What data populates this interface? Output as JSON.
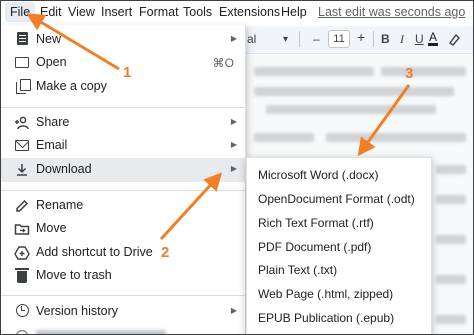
{
  "menubar": {
    "items": [
      "File",
      "Edit",
      "View",
      "Insert",
      "Format",
      "Tools",
      "Extensions",
      "Help"
    ],
    "last_edit": "Last edit was seconds ago"
  },
  "toolbar": {
    "partial_text": "al",
    "dropdown_caret": "▾",
    "minus": "–",
    "font_size": "11",
    "plus": "+",
    "bold": "B",
    "italic": "I",
    "underline": "U",
    "text_color": "A"
  },
  "file_menu": {
    "items": [
      {
        "icon": "document-icon",
        "label": "New",
        "submenu": true
      },
      {
        "icon": "folder-icon",
        "label": "Open",
        "shortcut": "⌘O"
      },
      {
        "icon": "copy-icon",
        "label": "Make a copy"
      },
      {
        "icon": "share-person-icon",
        "label": "Share",
        "submenu": true
      },
      {
        "icon": "mail-icon",
        "label": "Email",
        "submenu": true
      },
      {
        "icon": "download-icon",
        "label": "Download",
        "submenu": true,
        "active": true
      },
      {
        "icon": "rename-icon",
        "label": "Rename"
      },
      {
        "icon": "move-icon",
        "label": "Move"
      },
      {
        "icon": "add-to-drive-icon",
        "label": "Add shortcut to Drive"
      },
      {
        "icon": "trash-icon",
        "label": "Move to trash"
      },
      {
        "icon": "history-icon",
        "label": "Version history",
        "submenu": true
      }
    ]
  },
  "download_submenu": {
    "items": [
      "Microsoft Word (.docx)",
      "OpenDocument Format (.odt)",
      "Rich Text Format (.rtf)",
      "PDF Document (.pdf)",
      "Plain Text (.txt)",
      "Web Page (.html, zipped)",
      "EPUB Publication (.epub)"
    ]
  },
  "annotations": {
    "step1": "1",
    "step2": "2",
    "step3": "3",
    "color": "#f07f26"
  }
}
